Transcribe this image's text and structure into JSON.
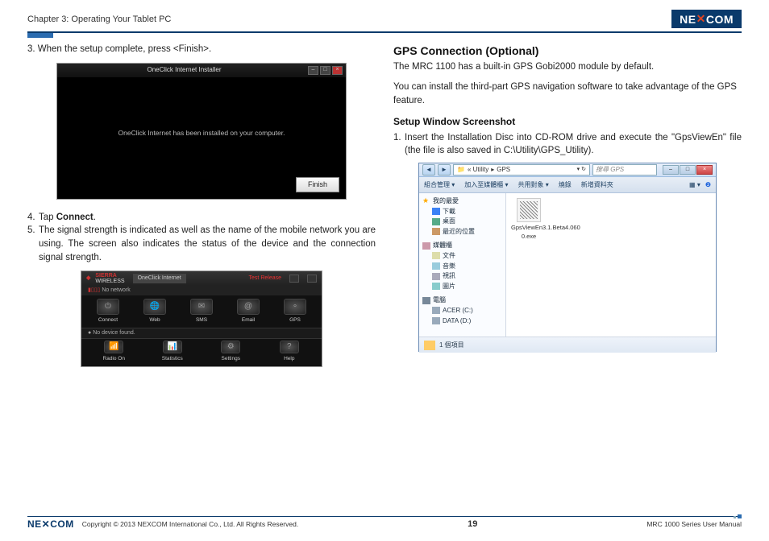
{
  "header": {
    "chapter": "Chapter 3: Operating Your Tablet PC",
    "logo": "NEXCOM"
  },
  "left": {
    "step3": "3. When the setup complete, press <Finish>.",
    "installer": {
      "title": "OneClick Internet Installer",
      "body": "OneClick Internet has been installed on your computer.",
      "finish": "Finish"
    },
    "step4_num": "4.",
    "step4_text_a": "Tap ",
    "step4_text_b": "Connect",
    "step4_text_c": ".",
    "step5_num": "5.",
    "step5_text": "The signal strength is indicated as well as the name of the mobile network you are using. The screen also indicates the status of the device and the connection signal strength.",
    "sierra": {
      "brand1": "SIERRA",
      "brand2": "WIRELESS",
      "oc": "OneClick Internet",
      "test": "Test Release",
      "nonet": "No network",
      "btns": [
        "Connect",
        "Web",
        "SMS",
        "Email",
        "GPS"
      ],
      "nodev": "No device found.",
      "btns2": [
        "Radio On",
        "Statistics",
        "Settings",
        "Help"
      ],
      "icons": [
        "⏻",
        "🌐",
        "✉",
        "@",
        "∘"
      ],
      "icons2": [
        "📶",
        "📊",
        "⚙",
        "?"
      ]
    }
  },
  "right": {
    "h2": "GPS Connection (Optional)",
    "p1": "The MRC 1100 has a built-in GPS Gobi2000 module by default.",
    "p2": "You can install the third-part GPS navigation software to take advantage of the GPS feature.",
    "h3": "Setup Window Screenshot",
    "step1_num": "1.",
    "step1_text": "Insert the Installation Disc into CD-ROM drive and execute the \"GpsViewEn\" file (the file is also saved in C:\\Utility\\GPS_Utility).",
    "explorer": {
      "path_a": "« Utility",
      "path_b": "GPS",
      "search": "搜尋 GPS",
      "toolbar": [
        "組合管理 ▾",
        "加入至媒體櫃 ▾",
        "共用對象 ▾",
        "燒錄",
        "新增資料夾"
      ],
      "tree": {
        "fav": "我的最愛",
        "fav_items": [
          "下載",
          "桌面",
          "最近的位置"
        ],
        "lib": "媒體櫃",
        "lib_items": [
          "文件",
          "音樂",
          "視訊",
          "圖片"
        ],
        "comp": "電腦",
        "comp_items": [
          "ACER (C:)",
          "DATA (D:)"
        ]
      },
      "file": "GpsViewEn3.1.Beta4.060 0.exe",
      "status": "1 個項目"
    }
  },
  "footer": {
    "logo": "NEXCOM",
    "copyright": "Copyright © 2013 NEXCOM International Co., Ltd. All Rights Reserved.",
    "page": "19",
    "manual": "MRC 1000 Series User Manual"
  }
}
